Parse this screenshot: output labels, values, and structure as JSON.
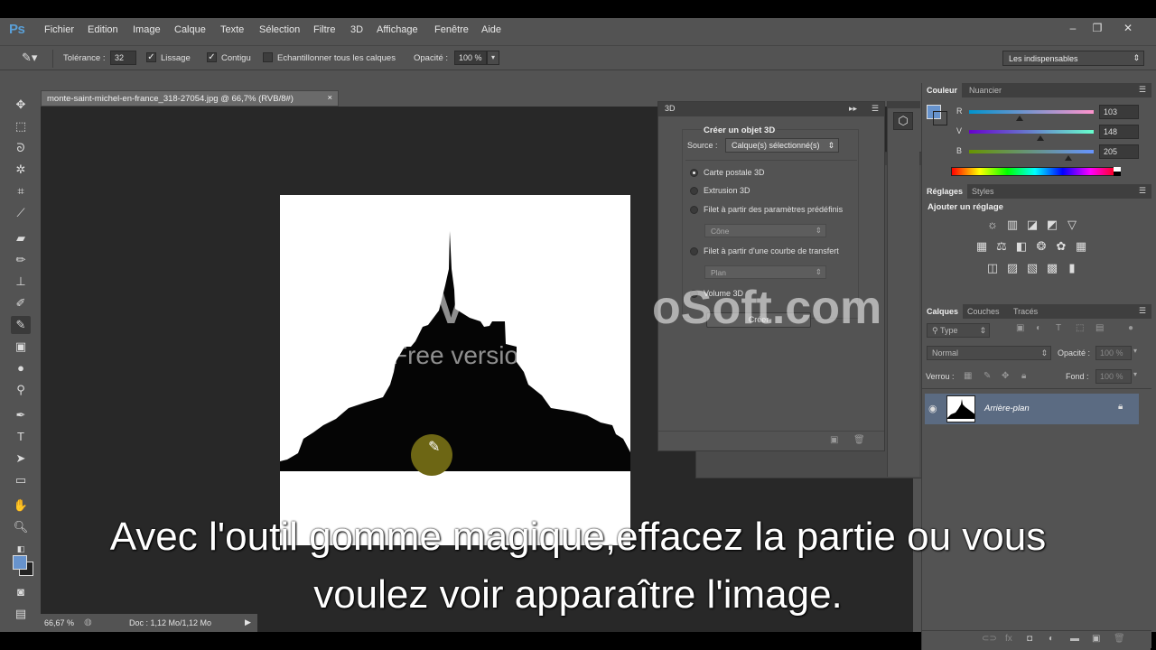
{
  "app": {
    "logo": "Ps"
  },
  "menu": [
    "Fichier",
    "Edition",
    "Image",
    "Calque",
    "Texte",
    "Sélection",
    "Filtre",
    "3D",
    "Affichage",
    "Fenêtre",
    "Aide"
  ],
  "window_controls": {
    "minimize": "–",
    "restore": "❐",
    "close": "✕"
  },
  "options": {
    "tolerance_label": "Tolérance :",
    "tolerance_value": "32",
    "lissage_label": "Lissage",
    "contigu_label": "Contigu",
    "echantillonner_label": "Echantillonner tous les calques",
    "opacity_label": "Opacité :",
    "opacity_value": "100 %",
    "workspace": "Les indispensables"
  },
  "document": {
    "tab_title": "monte-saint-michel-en-france_318-27054.jpg @ 66,7% (RVB/8#)",
    "zoom": "66,67 %",
    "doc_info": "Doc : 1,12 Mo/1,12 Mo"
  },
  "panel3d": {
    "tab": "3D",
    "title": "Créer un objet 3D",
    "source_label": "Source :",
    "source_value": "Calque(s) sélectionné(s)",
    "options": [
      {
        "label": "Carte postale 3D",
        "selected": true
      },
      {
        "label": "Extrusion 3D",
        "selected": false
      },
      {
        "label": "Filet à partir des paramètres prédéfinis",
        "selected": false
      },
      {
        "label": "Filet à partir d'une courbe de transfert",
        "selected": false
      },
      {
        "label": "Volume 3D",
        "selected": false
      }
    ],
    "preset_select": "Cône",
    "curve_select": "Plan",
    "create_button": "Créer"
  },
  "color_panel": {
    "tabs": [
      "Couleur",
      "Nuancier"
    ],
    "fg_color": "#6793cd",
    "r_label": "R",
    "r_value": "103",
    "v_label": "V",
    "v_value": "148",
    "b_label": "B",
    "b_value": "205"
  },
  "adjustments_panel": {
    "tabs": [
      "Réglages",
      "Styles"
    ],
    "title": "Ajouter un réglage"
  },
  "layers_panel": {
    "tabs": [
      "Calques",
      "Couches",
      "Tracés"
    ],
    "filter": "Type",
    "blend_mode": "Normal",
    "opacity_label": "Opacité :",
    "opacity_value": "100 %",
    "lock_label": "Verrou :",
    "fill_label": "Fond :",
    "fill_value": "100 %",
    "layer_name": "Arrière-plan"
  },
  "overlay": {
    "watermark": "VSDC Free Video Soft.com",
    "watermark_visible_left": "V",
    "watermark_visible_right": "oSoft.com",
    "watermark_sub": "Free versio",
    "subtitle_line1": "Avec l'outil gomme magique,effacez la partie ou vous",
    "subtitle_line2": "voulez voir apparaître l'image."
  }
}
